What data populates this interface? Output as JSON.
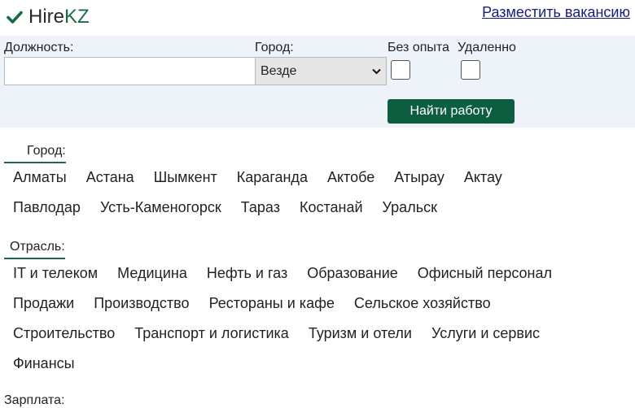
{
  "header": {
    "logo_part1": "Hire",
    "logo_part2": "KZ",
    "post_vacancy": "Разместить вакансию",
    "brand_color": "#1a6b45"
  },
  "search": {
    "position_label": "Должность:",
    "position_value": "",
    "city_label": "Город:",
    "city_selected": "Везде",
    "no_experience_label": "Без опыта",
    "remote_label": "Удаленно",
    "submit_label": "Найти работу"
  },
  "cities": {
    "title": "Город:",
    "rows": [
      [
        "Алматы",
        "Астана",
        "Шымкент",
        "Караганда",
        "Актобе",
        "Атырау",
        "Актау"
      ],
      [
        "Павлодар",
        "Усть-Каменогорск",
        "Тараз",
        "Костанай",
        "Уральск"
      ]
    ]
  },
  "industries": {
    "title": "Отрасль:",
    "rows": [
      [
        "IT и телеком",
        "Медицина",
        "Нефть и газ",
        "Образование",
        "Офисный персонал"
      ],
      [
        "Продажи",
        "Производство",
        "Рестораны и кафе",
        "Сельское хозяйство"
      ],
      [
        "Строительство",
        "Транспорт и логистика",
        "Туризм и отели",
        "Услуги и сервис"
      ],
      [
        "Финансы"
      ]
    ]
  },
  "salary": {
    "title": "Зарплата:"
  }
}
